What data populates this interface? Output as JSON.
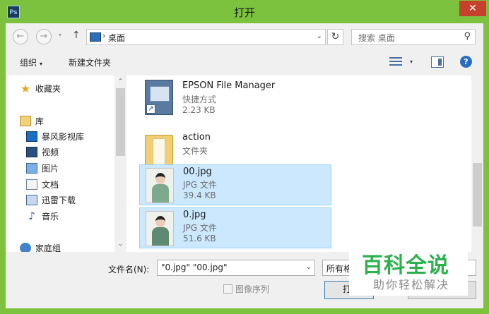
{
  "window": {
    "title": "打开",
    "app_icon_text": "Ps",
    "close_glyph": "✕"
  },
  "nav": {
    "back_glyph": "←",
    "forward_glyph": "→",
    "dropdown_glyph": "▾",
    "up_glyph": "↑",
    "address_sep": "›",
    "address_path": "桌面",
    "address_drop": "⌄",
    "refresh_glyph": "↻",
    "search_placeholder": "搜索 桌面",
    "search_glyph": "⚲"
  },
  "toolbar": {
    "organize": "组织",
    "caret": "▾",
    "new_folder": "新建文件夹",
    "help_glyph": "?"
  },
  "navpane": {
    "favorites": "收藏夹",
    "library": "库",
    "library_items": [
      "暴风影视库",
      "视频",
      "图片",
      "文档",
      "迅雷下载",
      "音乐"
    ],
    "homegroup": "家庭组",
    "star_glyph": "★",
    "music_glyph": "♪"
  },
  "files": [
    {
      "name": "EPSON File Manager",
      "type": "快捷方式",
      "size": "2.23 KB",
      "kind": "shortcut",
      "selected": false
    },
    {
      "name": "action",
      "type": "文件夹",
      "size": "",
      "kind": "folder",
      "selected": false
    },
    {
      "name": "00.jpg",
      "type": "JPG 文件",
      "size": "39.4 KB",
      "kind": "photo",
      "selected": true
    },
    {
      "name": "0.jpg",
      "type": "JPG 文件",
      "size": "51.6 KB",
      "kind": "photo",
      "selected": true
    }
  ],
  "bottom": {
    "filename_label": "文件名(N):",
    "filename_value": "\"0.jpg\" \"00.jpg\"",
    "filetype_value": "所有格",
    "image_sequence_label": "图像序列",
    "open_label": "打",
    "dropdown_glyph": "⌄"
  },
  "scroll": {
    "up_glyph": "⌃",
    "down_glyph": "⌄"
  },
  "watermark": {
    "title": "百科全说",
    "subtitle": "助你轻松解决"
  },
  "colors": {
    "frame": "#7cc23f",
    "selection": "#cce8ff",
    "watermark": "#2bb24c"
  }
}
